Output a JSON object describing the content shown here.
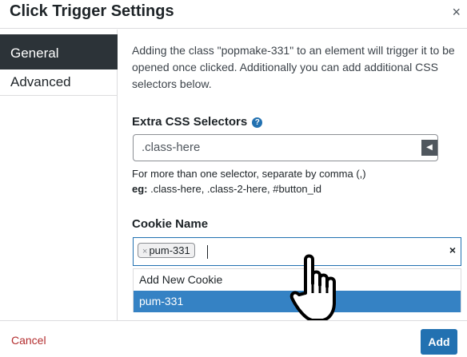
{
  "dialog": {
    "title": "Click Trigger Settings",
    "close_glyph": "×"
  },
  "sidebar": {
    "tabs": [
      {
        "label": "General",
        "active": true
      },
      {
        "label": "Advanced",
        "active": false
      }
    ]
  },
  "general": {
    "description": "Adding the class \"popmake-331\" to an element will trigger it to be opened once clicked. Additionally you can add additional CSS selectors below.",
    "extra_css": {
      "label": "Extra CSS Selectors",
      "help_glyph": "?",
      "placeholder": ".class-here",
      "hint_line1": "For more than one selector, separate by comma (,)",
      "hint_eg_label": "eg:",
      "hint_eg_value": " .class-here, .class-2-here, #button_id"
    },
    "cookie": {
      "label": "Cookie Name",
      "selected_token": "pum-331",
      "token_remove_glyph": "×",
      "clear_glyph": "×",
      "options": [
        {
          "label": "Add New Cookie",
          "highlighted": false
        },
        {
          "label": "pum-331",
          "highlighted": true
        }
      ]
    }
  },
  "footer": {
    "cancel_label": "Cancel",
    "add_label": "Add"
  },
  "colors": {
    "accent": "#2271b1",
    "active_tab_bg": "#2c3338",
    "highlight_option": "#3582c4",
    "cancel_red": "#b32d2e"
  },
  "icons": {
    "help": "question-circle-icon",
    "arrow": "arrow-left-icon",
    "cursor": "hand-pointer-cursor-icon"
  }
}
